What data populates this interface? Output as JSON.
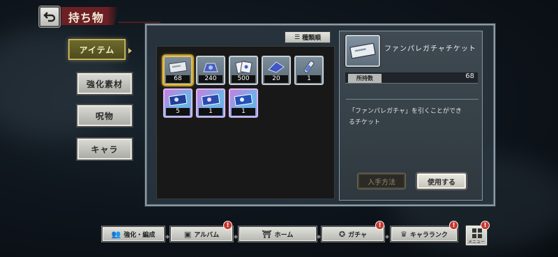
{
  "header": {
    "title": "持ち物",
    "back_icon": "return-arrow-icon"
  },
  "sidebar": {
    "tabs": [
      {
        "label": "アイテム",
        "active": true
      },
      {
        "label": "強化素材",
        "active": false
      },
      {
        "label": "呪物",
        "active": false
      },
      {
        "label": "キャラ",
        "active": false
      }
    ]
  },
  "inventory": {
    "sort_label": "種類順",
    "items": [
      {
        "count": "68",
        "icon": "ticket-icon",
        "rarity": "normal",
        "selected": true
      },
      {
        "count": "240",
        "icon": "gem-pouch-icon",
        "rarity": "normal",
        "selected": false
      },
      {
        "count": "500",
        "icon": "cards-icon",
        "rarity": "normal",
        "selected": false
      },
      {
        "count": "20",
        "icon": "blue-scroll-icon",
        "rarity": "normal",
        "selected": false
      },
      {
        "count": "1",
        "icon": "vial-icon",
        "rarity": "normal",
        "selected": false
      },
      {
        "count": "5",
        "icon": "rare-ticket-icon",
        "rarity": "rare",
        "selected": false
      },
      {
        "count": "1",
        "icon": "rare-ticket-icon",
        "rarity": "rare",
        "selected": false
      },
      {
        "count": "1",
        "icon": "rare-ticket-icon",
        "rarity": "rare",
        "selected": false
      }
    ]
  },
  "detail": {
    "name": "ファンパレガチャチケット",
    "owned_label": "所持数",
    "owned_value": "68",
    "description_line1": "「ファンパレガチャ」を引くことができ",
    "description_line2": "るチケット",
    "obtain_button": "入手方法",
    "use_button": "使用する"
  },
  "nav": {
    "items": [
      {
        "label": "強化・編成",
        "icon": "team-icon",
        "badge": false
      },
      {
        "label": "アルバム",
        "icon": "album-icon",
        "badge": true
      },
      {
        "label": "ホーム",
        "icon": "home-icon",
        "badge": false
      },
      {
        "label": "ガチャ",
        "icon": "gacha-icon",
        "badge": true
      },
      {
        "label": "キャラランク",
        "icon": "rank-icon",
        "badge": true
      }
    ],
    "menu_label": "メニュー",
    "badge_text": "!"
  },
  "colors": {
    "accent_red": "#6c1f24",
    "selected_gold": "#e5c25a",
    "badge_red": "#c4362d"
  }
}
